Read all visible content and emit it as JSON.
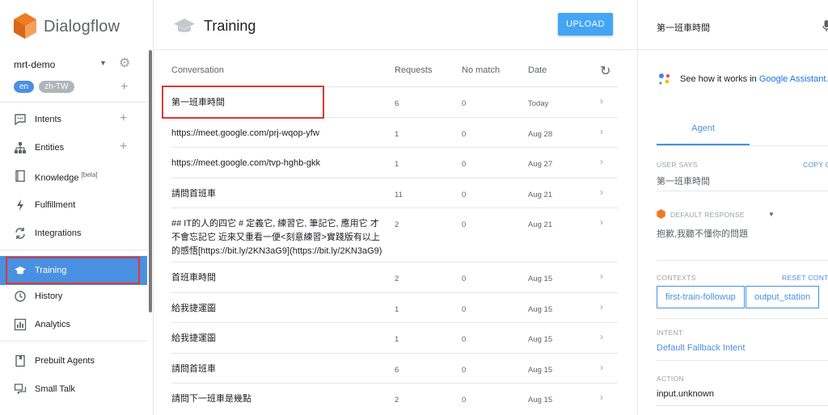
{
  "brand": {
    "name": "Dialogflow"
  },
  "agent": {
    "name": "mrt-demo"
  },
  "languages": [
    {
      "code": "en",
      "active": true
    },
    {
      "code": "zh-TW",
      "active": false
    }
  ],
  "nav": {
    "intents": "Intents",
    "entities": "Entities",
    "knowledge": "Knowledge",
    "knowledge_badge": "[beta]",
    "fulfillment": "Fulfillment",
    "integrations": "Integrations",
    "training": "Training",
    "history": "History",
    "analytics": "Analytics",
    "prebuilt_agents": "Prebuilt Agents",
    "small_talk": "Small Talk"
  },
  "main": {
    "title": "Training",
    "upload_label": "UPLOAD",
    "columns": {
      "conversation": "Conversation",
      "requests": "Requests",
      "no_match": "No match",
      "date": "Date"
    },
    "rows": [
      {
        "conversation": "第一班車時間",
        "requests": "6",
        "no_match": "0",
        "date": "Today"
      },
      {
        "conversation": "https://meet.google.com/prj-wqop-yfw",
        "requests": "1",
        "no_match": "0",
        "date": "Aug 28"
      },
      {
        "conversation": "https://meet.google.com/tvp-hghb-gkk",
        "requests": "1",
        "no_match": "0",
        "date": "Aug 27"
      },
      {
        "conversation": "請問首班車",
        "requests": "11",
        "no_match": "0",
        "date": "Aug 21"
      },
      {
        "conversation": "## IT的人的四它 # 定義它, 練習它, 筆記它, 應用它 才不會忘記它 近來又重看一便<刻意練習>實踐版有以上的感悟[https://bit.ly/2KN3aG9](https://bit.ly/2KN3aG9)",
        "requests": "2",
        "no_match": "0",
        "date": "Aug 21"
      },
      {
        "conversation": "首班車時間",
        "requests": "2",
        "no_match": "0",
        "date": "Aug 15"
      },
      {
        "conversation": "給我捷運圖",
        "requests": "1",
        "no_match": "0",
        "date": "Aug 15"
      },
      {
        "conversation": "給我捷運圖",
        "requests": "1",
        "no_match": "0",
        "date": "Aug 15"
      },
      {
        "conversation": "請問首班車",
        "requests": "6",
        "no_match": "0",
        "date": "Aug 15"
      },
      {
        "conversation": "請問下一班車是幾點",
        "requests": "2",
        "no_match": "0",
        "date": "Aug 15"
      }
    ]
  },
  "right": {
    "query": "第一班車時間",
    "assistant_text": "See how it works in ",
    "assistant_link": "Google Assistant.",
    "tab": "Agent",
    "user_says_label": "USER SAYS",
    "copy_label": "COPY C",
    "user_says_value": "第一班車時間",
    "default_response_label": "DEFAULT RESPONSE",
    "default_response_value": "抱歉,我聽不懂你的問題",
    "contexts_label": "CONTEXTS",
    "reset_label": "RESET CONTE",
    "contexts": [
      "first-train-followup",
      "output_station"
    ],
    "intent_label": "INTENT",
    "intent_value": "Default Fallback Intent",
    "action_label": "ACTION",
    "action_value": "input.unknown"
  },
  "colors": {
    "accent": "#4a90e2",
    "upload": "#42a5f5",
    "highlight": "#d93a32",
    "brand_orange": "#ef7b22"
  }
}
